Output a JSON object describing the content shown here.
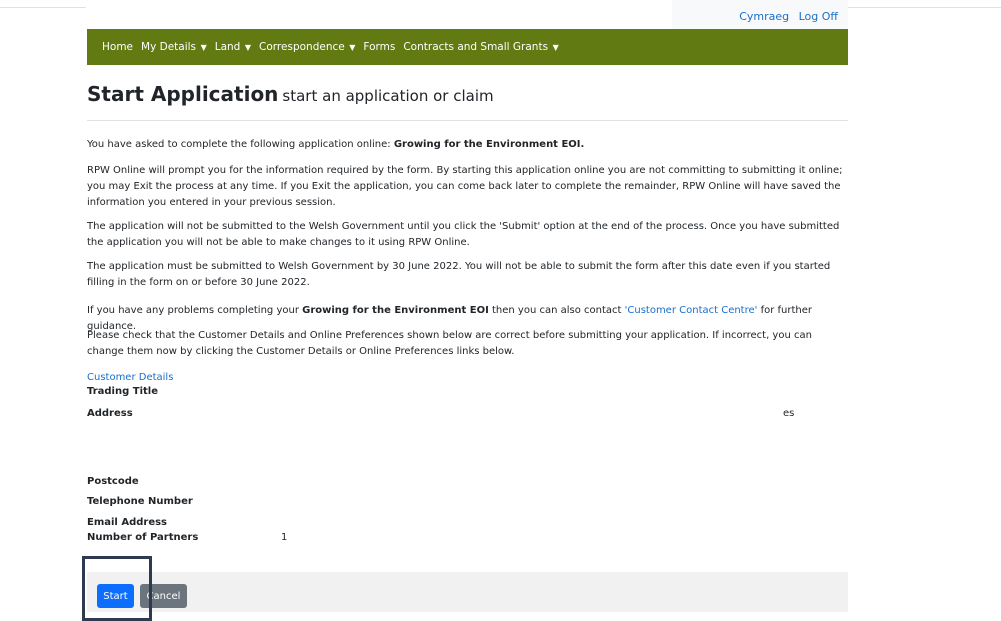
{
  "header": {
    "lang_link": "Cymraeg",
    "logoff_link": "Log Off"
  },
  "nav": {
    "items": [
      {
        "label": "Home",
        "dropdown": false
      },
      {
        "label": "My Details",
        "dropdown": true
      },
      {
        "label": "Land",
        "dropdown": true
      },
      {
        "label": "Correspondence",
        "dropdown": true
      },
      {
        "label": "Forms",
        "dropdown": false
      },
      {
        "label": "Contracts and Small Grants",
        "dropdown": true
      }
    ]
  },
  "page": {
    "title": "Start Application",
    "subtitle": "start an application or claim",
    "p1_prefix": "You have asked to complete the following application online: ",
    "p1_bold": "Growing for the Environment EOI.",
    "p2": "RPW Online will prompt you for the information required by the form. By starting this application online you are not committing to submitting it online; you may Exit the process at any time. If you Exit the application, you can come back later to complete the remainder, RPW Online will have saved the information you entered in your previous session.",
    "p3": "The application will not be submitted to the Welsh Government until you click the 'Submit' option at the end of the process. Once you have submitted the application you will not be able to make changes to it using RPW Online.",
    "p4": "The application must be submitted to Welsh Government by 30 June 2022. You will not be able to submit the form after this date even if you started filling in the form on or before 30 June 2022.",
    "p5_prefix": "If you have any problems completing your ",
    "p5_bold": "Growing for the Environment EOI",
    "p5_mid": " then you can also contact ",
    "p5_link": "'Customer Contact Centre'",
    "p5_suffix": " for further guidance.",
    "p6": "Please check that the Customer Details and Online Preferences shown below are correct before submitting your application. If incorrect, you can change them now by clicking the Customer Details or Online Preferences links below."
  },
  "customer": {
    "link": "Customer Details",
    "trading_title_label": "Trading Title",
    "address_label": "Address",
    "address_value": "es",
    "postcode_label": "Postcode",
    "telephone_label": "Telephone Number",
    "email_label": "Email Address",
    "partners_label": "Number of Partners",
    "partners_value": "1"
  },
  "buttons": {
    "start": "Start",
    "cancel": "Cancel"
  },
  "colors": {
    "nav_bg": "#617a12",
    "link": "#1a6fc8",
    "primary": "#0d6efd",
    "secondary": "#6c757d"
  }
}
